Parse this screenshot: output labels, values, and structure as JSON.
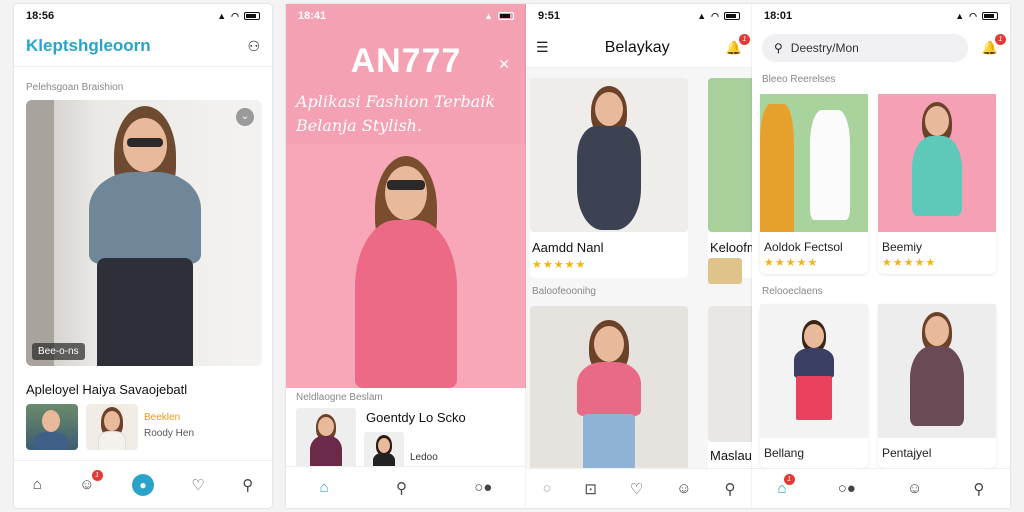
{
  "s1": {
    "time": "18:56",
    "app_title": "Kleptshgleoorn",
    "section_label": "Pelehsgoan Braishion",
    "photo_caption": "Bee-o-ns",
    "product_title": "Apleloyel Haiya Savaojebatl",
    "mini1_label": "Beeklen",
    "mini2_label": "Roody Hen"
  },
  "s2": {
    "time": "18:41",
    "brand": "AN777",
    "tagline_1": "Aplikasi Fashion Terbaik",
    "tagline_2": "Belanja Stylish.",
    "section_label": "Neldlaogne Beslam",
    "product_title": "Goentdy Lo Scko",
    "mini_label": "Ledoo"
  },
  "s3": {
    "time": "9:51",
    "title": "Belaykay",
    "card1_title": "Aamdd Nanl",
    "card2_title": "Keloofm",
    "section_label": "Baloofeoonihg",
    "card3_title": "Maslau"
  },
  "s4": {
    "time": "18:01",
    "search_placeholder": "Deestry/Mon",
    "section_label_1": "Bleeo Reerelses",
    "card1_title": "Aoldok Fectsol",
    "card2_title": "Beemiy",
    "section_label_2": "Relooeclaens",
    "card3_title": "Bellang",
    "card4_title": "Pentajyel"
  },
  "colors": {
    "accent": "#2aa3c9",
    "pink": "#f39aad",
    "badge": "#e53935"
  }
}
